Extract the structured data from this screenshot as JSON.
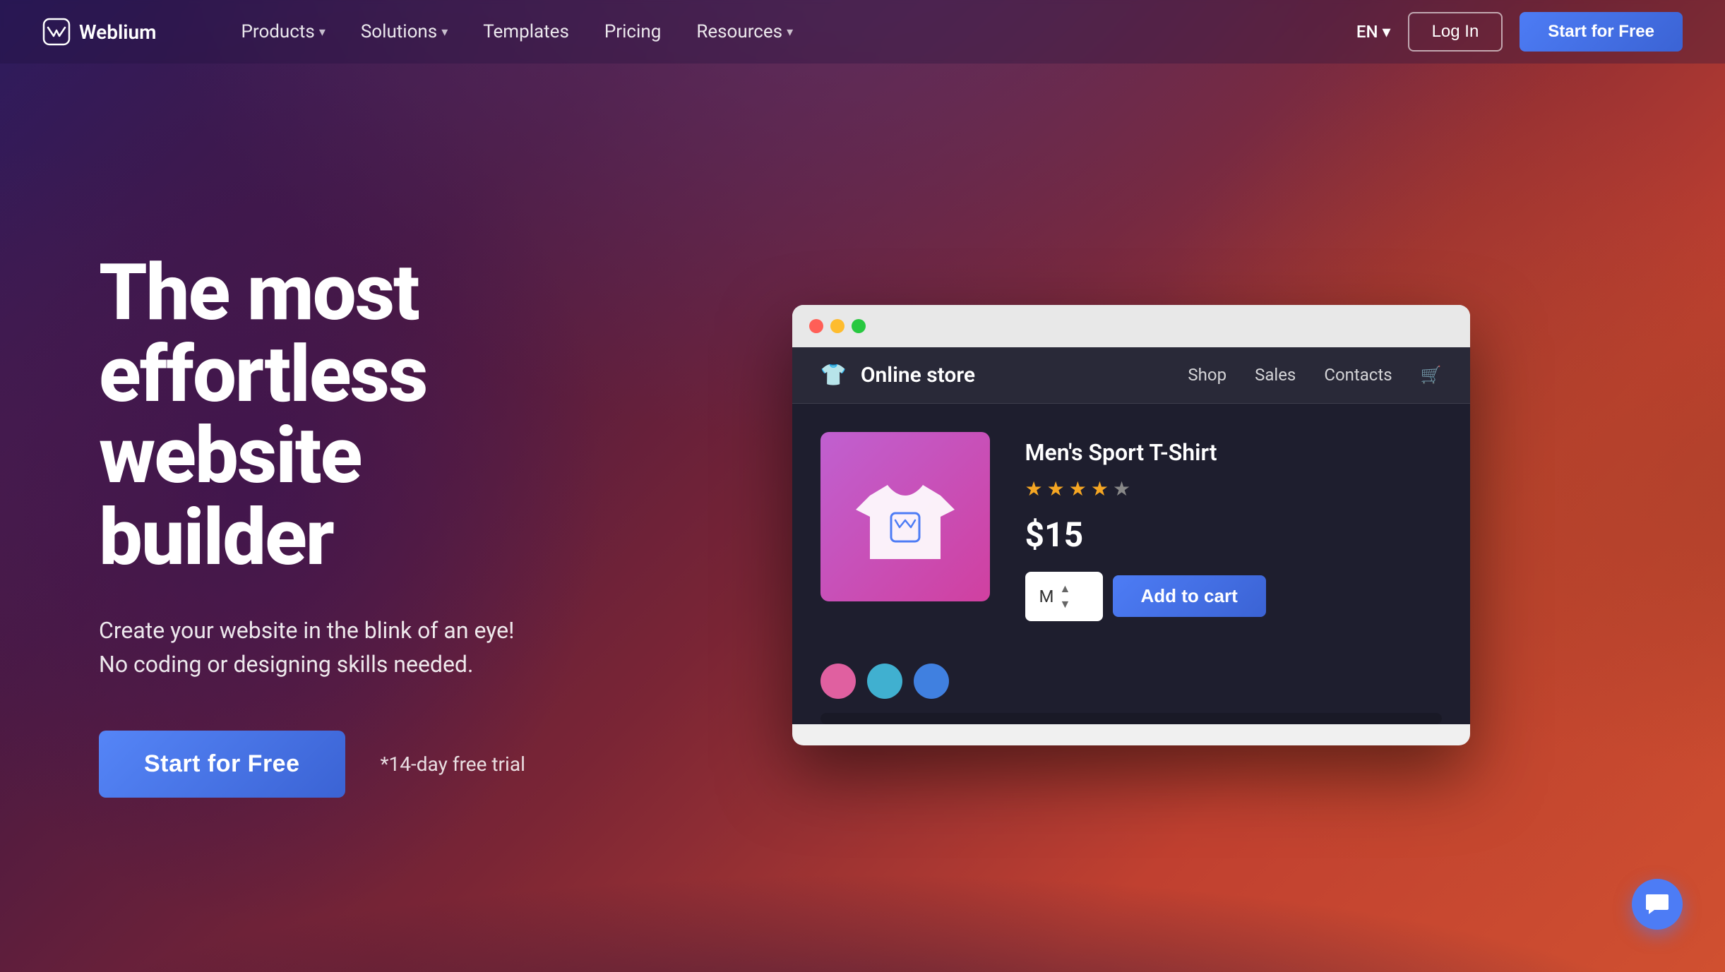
{
  "brand": {
    "name": "Weblium"
  },
  "nav": {
    "logo_text": "Weblium",
    "links": [
      {
        "label": "Products",
        "has_dropdown": true
      },
      {
        "label": "Solutions",
        "has_dropdown": true
      },
      {
        "label": "Templates",
        "has_dropdown": false
      },
      {
        "label": "Pricing",
        "has_dropdown": false
      },
      {
        "label": "Resources",
        "has_dropdown": true
      }
    ],
    "lang": "EN",
    "login_label": "Log In",
    "start_label": "Start for Free"
  },
  "hero": {
    "title_line1": "The most",
    "title_line2": "effortless",
    "title_line3": "website builder",
    "subtitle_line1": "Create your website in the blink of an eye!",
    "subtitle_line2": "No coding or designing skills needed.",
    "cta_label": "Start for Free",
    "trial_text": "*14-day free trial"
  },
  "mockup": {
    "store": {
      "icon": "👕",
      "title": "Online store",
      "nav_links": [
        "Shop",
        "Sales",
        "Contacts"
      ],
      "product": {
        "name": "Men's Sport T-Shirt",
        "rating": 4.5,
        "stars_filled": 4,
        "stars_half": 1,
        "price": "$15",
        "size_default": "M",
        "add_to_cart_label": "Add to cart"
      }
    }
  },
  "chat": {
    "icon": "chat-icon"
  }
}
